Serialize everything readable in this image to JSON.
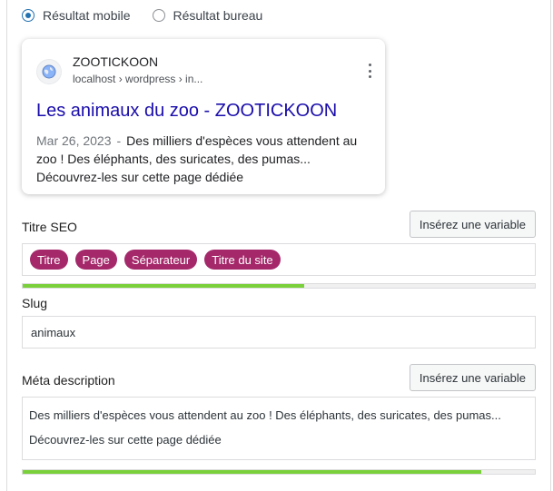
{
  "preview_mode": {
    "options": [
      {
        "label": "Résultat mobile",
        "selected": true
      },
      {
        "label": "Résultat bureau",
        "selected": false
      }
    ]
  },
  "preview_card": {
    "site_name": "ZOOTICKOON",
    "breadcrumb": "localhost › wordpress › in...",
    "title": "Les animaux du zoo - ZOOTICKOON",
    "date": "Mar 26, 2023",
    "date_separator": "-",
    "description": "Des milliers d'espèces vous attendent au zoo ! Des éléphants, des suricates, des pumas... Découvrez-les sur cette page dédiée",
    "title_color": "#1a0dab",
    "favicon_icon": "globe-icon",
    "menu_icon": "more-vertical-icon"
  },
  "seo_title": {
    "label": "Titre SEO",
    "button_label": "Insérez une variable",
    "variables": [
      "Titre",
      "Page",
      "Séparateur",
      "Titre du site"
    ],
    "pill_color": "#a4286a",
    "progress_fraction": 0.55,
    "progress_color": "#7ad03a"
  },
  "slug": {
    "label": "Slug",
    "value": "animaux"
  },
  "meta_description": {
    "label": "Méta description",
    "button_label": "Insérez une variable",
    "line1": "Des milliers d'espèces vous attendent au zoo ! Des éléphants, des suricates, des pumas...",
    "line2": "Découvrez-les sur cette page dédiée",
    "progress_fraction": 0.895,
    "progress_color": "#7ad03a"
  }
}
